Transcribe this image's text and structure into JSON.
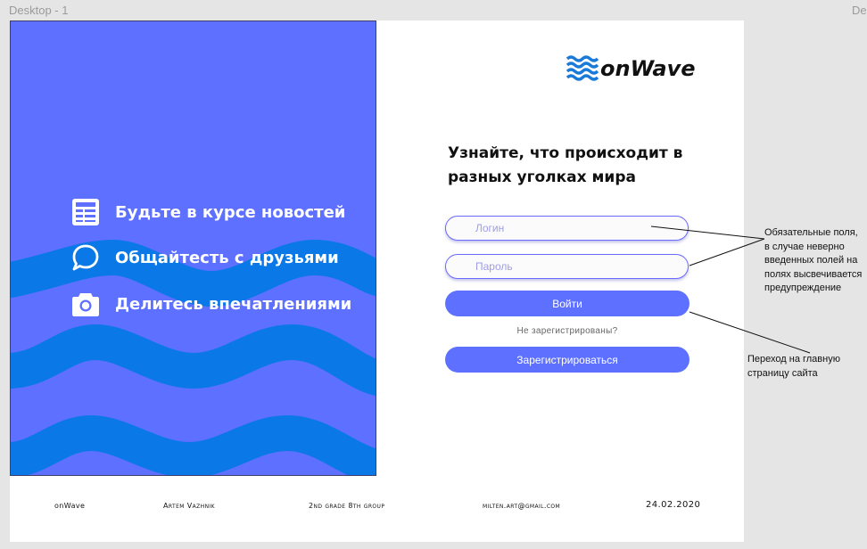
{
  "frame": {
    "label": "Desktop - 1",
    "next_label": "De"
  },
  "features": [
    {
      "icon": "newspaper-icon",
      "label": "Будьте в курсе новостей"
    },
    {
      "icon": "chat-bubble-icon",
      "label": "Общайтесть с друзьями"
    },
    {
      "icon": "camera-icon",
      "label": "Делитесь впечатлениями"
    }
  ],
  "logo": {
    "text": "onWave"
  },
  "headline": "Узнайте, что происходит в разных уголках мира",
  "form": {
    "login_placeholder": "Логин",
    "password_placeholder": "Пароль",
    "login_button": "Войти",
    "not_registered": "Не зарегистрированы?",
    "register_button": "Зарегистрироваться"
  },
  "annotations": {
    "required_fields": "Обязательные поля, в случае неверно введенных полей на полях высвечивается предупреждение",
    "main_page": "Переход на главную страницу сайта"
  },
  "footer": {
    "brand": "onWave",
    "author": "Artem Vazhnik",
    "group": "2nd grade 8th group",
    "email": "milten.art@gmail.com",
    "date": "24.02.2020"
  },
  "colors": {
    "panel": "#5d70ff",
    "wave": "#0a78e6",
    "button": "#5d70ff",
    "logo_wave": "#1a7ad9"
  }
}
